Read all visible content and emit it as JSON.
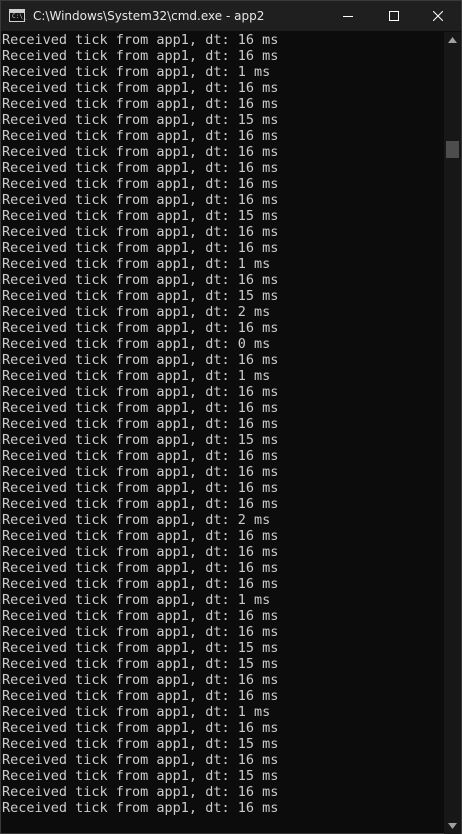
{
  "window": {
    "title": "C:\\Windows\\System32\\cmd.exe - app2",
    "icon": "cmd-console-icon",
    "icon_prompt": "C:\\_"
  },
  "console": {
    "lines": [
      "Received tick from app1, dt: 16 ms",
      "Received tick from app1, dt: 16 ms",
      "Received tick from app1, dt: 1 ms",
      "Received tick from app1, dt: 16 ms",
      "Received tick from app1, dt: 16 ms",
      "Received tick from app1, dt: 15 ms",
      "Received tick from app1, dt: 16 ms",
      "Received tick from app1, dt: 16 ms",
      "Received tick from app1, dt: 16 ms",
      "Received tick from app1, dt: 16 ms",
      "Received tick from app1, dt: 16 ms",
      "Received tick from app1, dt: 15 ms",
      "Received tick from app1, dt: 16 ms",
      "Received tick from app1, dt: 16 ms",
      "Received tick from app1, dt: 1 ms",
      "Received tick from app1, dt: 16 ms",
      "Received tick from app1, dt: 15 ms",
      "Received tick from app1, dt: 2 ms",
      "Received tick from app1, dt: 16 ms",
      "Received tick from app1, dt: 0 ms",
      "Received tick from app1, dt: 16 ms",
      "Received tick from app1, dt: 1 ms",
      "Received tick from app1, dt: 16 ms",
      "Received tick from app1, dt: 16 ms",
      "Received tick from app1, dt: 16 ms",
      "Received tick from app1, dt: 15 ms",
      "Received tick from app1, dt: 16 ms",
      "Received tick from app1, dt: 16 ms",
      "Received tick from app1, dt: 16 ms",
      "Received tick from app1, dt: 16 ms",
      "Received tick from app1, dt: 2 ms",
      "Received tick from app1, dt: 16 ms",
      "Received tick from app1, dt: 16 ms",
      "Received tick from app1, dt: 16 ms",
      "Received tick from app1, dt: 16 ms",
      "Received tick from app1, dt: 1 ms",
      "Received tick from app1, dt: 16 ms",
      "Received tick from app1, dt: 16 ms",
      "Received tick from app1, dt: 15 ms",
      "Received tick from app1, dt: 15 ms",
      "Received tick from app1, dt: 16 ms",
      "Received tick from app1, dt: 16 ms",
      "Received tick from app1, dt: 1 ms",
      "Received tick from app1, dt: 16 ms",
      "Received tick from app1, dt: 15 ms",
      "Received tick from app1, dt: 16 ms",
      "Received tick from app1, dt: 15 ms",
      "Received tick from app1, dt: 16 ms",
      "Received tick from app1, dt: 16 ms"
    ]
  },
  "colors": {
    "background": "#0c0c0c",
    "text": "#cccccc",
    "titlebar": "#1f1f1f"
  },
  "controls": {
    "minimize_icon": "minimize-icon",
    "maximize_icon": "maximize-icon",
    "close_icon": "close-icon"
  }
}
